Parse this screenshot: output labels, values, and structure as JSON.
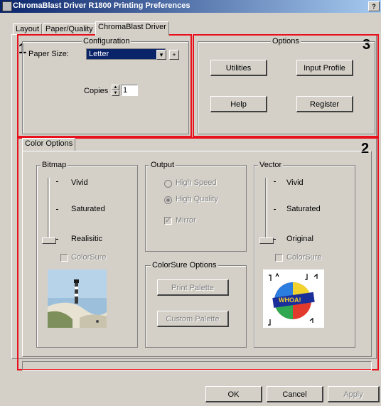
{
  "window": {
    "title": "ChromaBlast Driver R1800 Printing Preferences",
    "help_glyph": "?"
  },
  "tabs": [
    {
      "label": "Layout"
    },
    {
      "label": "Paper/Quality"
    },
    {
      "label": "ChromaBlast Driver"
    }
  ],
  "annotations": {
    "one": "1",
    "two": "2",
    "three": "3",
    "color": "#e8101c"
  },
  "configuration": {
    "title": "Configuration",
    "paper_size_label": "Paper Size:",
    "paper_size_value": "Letter",
    "plus_label": "+",
    "copies_label": "Copies",
    "copies_value": "1"
  },
  "options": {
    "title": "Options",
    "utilities": "Utilities",
    "input_profile": "Input Profile",
    "help": "Help",
    "register": "Register"
  },
  "color_options": {
    "tab_label": "Color Options",
    "bitmap": {
      "title": "Bitmap",
      "levels": [
        "Vivid",
        "Saturated",
        "Realisitic"
      ],
      "colorsure": "ColorSure"
    },
    "output": {
      "title": "Output",
      "high_speed": "High Speed",
      "high_quality": "High Quality",
      "mirror": "Mirror"
    },
    "colorsure_options": {
      "title": "ColorSure Options",
      "print_palette": "Print Palette",
      "custom_palette": "Custom Palette"
    },
    "vector": {
      "title": "Vector",
      "levels": [
        "Vivid",
        "Saturated",
        "Original"
      ],
      "colorsure": "ColorSure"
    }
  },
  "footer": {
    "ok": "OK",
    "cancel": "Cancel",
    "apply": "Apply"
  }
}
